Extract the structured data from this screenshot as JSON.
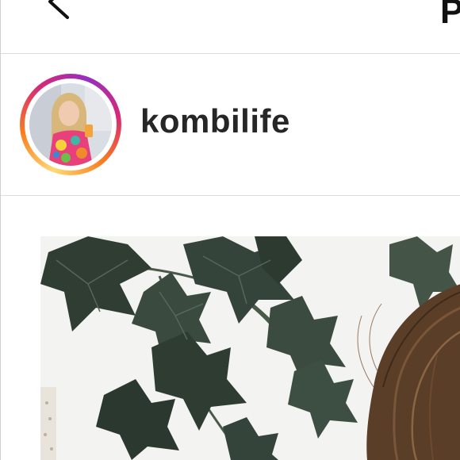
{
  "nav": {
    "title": "P",
    "back_icon": "chevron-left-icon"
  },
  "post": {
    "username": "kombilife",
    "story_ring_colors": [
      "#feda75",
      "#fa7e1e",
      "#d62976",
      "#962fbf"
    ],
    "image_subject": "ivy-leaves-and-hair-photo"
  }
}
